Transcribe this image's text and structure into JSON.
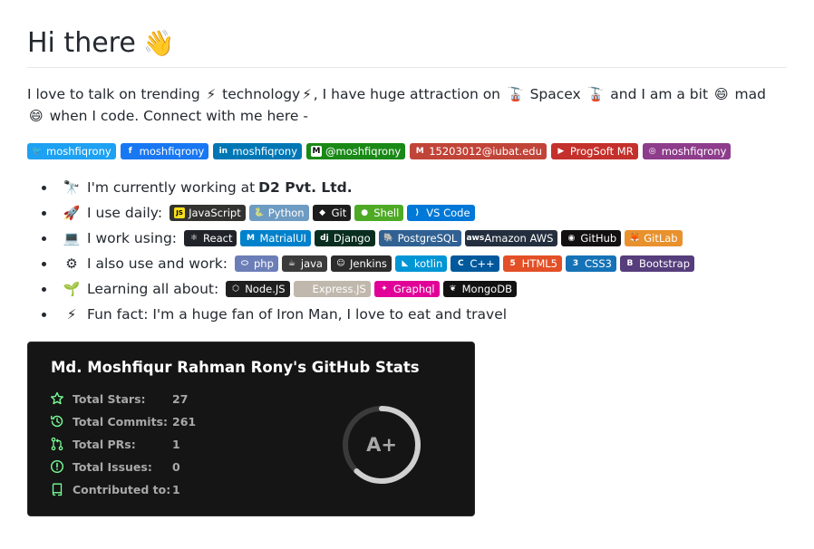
{
  "heading": {
    "text": "Hi there",
    "emoji": "👋"
  },
  "intro": {
    "p1": "I love to talk on trending",
    "e1": "⚡",
    "p2": "technology",
    "e2": "⚡",
    "p3": ", I have huge attraction on",
    "e3": "🚡",
    "p4": "Spacex",
    "e4": "🚡",
    "p5": "and I am a bit",
    "e5": "😄",
    "p6": "mad",
    "e6": "😄",
    "p7": "when I code. Connect with me here -"
  },
  "social": [
    {
      "label": "moshfiqrony",
      "icon": "twitter-icon",
      "glyph": "🐦",
      "color": "#1DA1F2"
    },
    {
      "label": "moshfiqrony",
      "icon": "facebook-icon",
      "glyph": "f",
      "color": "#1877F2"
    },
    {
      "label": "moshfiqrony",
      "icon": "linkedin-icon",
      "glyph": "in",
      "color": "#0077B5"
    },
    {
      "label": "@moshfiqrony",
      "icon": "medium-icon",
      "glyph": "M",
      "color": "#12100E",
      "accent": "#1a8917"
    },
    {
      "label": "15203012@iubat.edu",
      "icon": "gmail-icon",
      "glyph": "M",
      "color": "#C14438"
    },
    {
      "label": "ProgSoft MR",
      "icon": "youtube-icon",
      "glyph": "▶",
      "color": "#C4302B"
    },
    {
      "label": "moshfiqrony",
      "icon": "instagram-icon",
      "glyph": "◎",
      "color": "#8E3C8C"
    }
  ],
  "list": {
    "work": {
      "emoji": "🔭",
      "text": "I'm currently working at",
      "strong": "D2 Pvt. Ltd."
    },
    "daily": {
      "emoji": "🚀",
      "text": "I use daily:",
      "badges": [
        {
          "label": "JavaScript",
          "icon": "javascript-icon",
          "glyph": "JS",
          "color": "#323330",
          "icolor": "#F7DF1E"
        },
        {
          "label": "Python",
          "icon": "python-icon",
          "glyph": "🐍",
          "color": "#3776AB",
          "faded": true
        },
        {
          "label": "Git",
          "icon": "git-icon",
          "glyph": "◆",
          "color": "#1d1d1d"
        },
        {
          "label": "Shell",
          "icon": "shell-icon",
          "glyph": "●",
          "color": "#4EAA25"
        },
        {
          "label": "VS Code",
          "icon": "vscode-icon",
          "glyph": "⟩",
          "color": "#0078D7"
        }
      ]
    },
    "using": {
      "emoji": "💻",
      "text": "I work using:",
      "badges": [
        {
          "label": "React",
          "icon": "react-icon",
          "glyph": "⚛",
          "color": "#20232A"
        },
        {
          "label": "MatrialUI",
          "icon": "materialui-icon",
          "glyph": "M",
          "color": "#0081CB"
        },
        {
          "label": "Django",
          "icon": "django-icon",
          "glyph": "dj",
          "color": "#092E20"
        },
        {
          "label": "PostgreSQL",
          "icon": "postgresql-icon",
          "glyph": "🐘",
          "color": "#316192"
        },
        {
          "label": "Amazon AWS",
          "icon": "aws-icon",
          "glyph": "aws",
          "color": "#232F3E"
        },
        {
          "label": "GitHub",
          "icon": "github-icon",
          "glyph": "◉",
          "color": "#121011"
        },
        {
          "label": "GitLab",
          "icon": "gitlab-icon",
          "glyph": "🦊",
          "color": "#E8912D"
        }
      ]
    },
    "also": {
      "emoji": "⚙",
      "text": "I also use and work:",
      "badges": [
        {
          "label": "php",
          "icon": "php-icon",
          "glyph": "⬭",
          "color": "#6C7EB7"
        },
        {
          "label": "java",
          "icon": "java-icon",
          "glyph": "☕",
          "color": "#3b3b3b"
        },
        {
          "label": "Jenkins",
          "icon": "jenkins-icon",
          "glyph": "☺",
          "color": "#2C2C2C"
        },
        {
          "label": "kotlin",
          "icon": "kotlin-icon",
          "glyph": "◣",
          "color": "#0095D5"
        },
        {
          "label": "C++",
          "icon": "cplusplus-icon",
          "glyph": "C",
          "color": "#00599C"
        },
        {
          "label": "HTML5",
          "icon": "html5-icon",
          "glyph": "5",
          "color": "#E34F26"
        },
        {
          "label": "CSS3",
          "icon": "css3-icon",
          "glyph": "3",
          "color": "#1572B6"
        },
        {
          "label": "Bootstrap",
          "icon": "bootstrap-icon",
          "glyph": "B",
          "color": "#563D7C"
        }
      ]
    },
    "learning": {
      "emoji": "🌱",
      "text": "Learning all about:",
      "badges": [
        {
          "label": "Node.JS",
          "icon": "nodejs-icon",
          "glyph": "⬡",
          "color": "#1f1f1f"
        },
        {
          "label": "Express.JS",
          "icon": "express-icon",
          "glyph": "",
          "color": "#A89D8E",
          "faded": true
        },
        {
          "label": "Graphql",
          "icon": "graphql-icon",
          "glyph": "✦",
          "color": "#E10098"
        },
        {
          "label": "MongoDB",
          "icon": "mongodb-icon",
          "glyph": "❦",
          "color": "#121212"
        }
      ]
    },
    "fun": {
      "emoji": "⚡",
      "text": "Fun fact: I'm a huge fan of Iron Man, I love to eat and travel"
    }
  },
  "stats": {
    "title": "Md. Moshfiqur Rahman Rony's GitHub Stats",
    "rows": [
      {
        "label": "Total Stars:",
        "value": "27",
        "icon": "star-icon"
      },
      {
        "label": "Total Commits:",
        "value": "261",
        "icon": "history-icon"
      },
      {
        "label": "Total PRs:",
        "value": "1",
        "icon": "pull-request-icon"
      },
      {
        "label": "Total Issues:",
        "value": "0",
        "icon": "issue-icon"
      },
      {
        "label": "Contributed to:",
        "value": "1",
        "icon": "repo-icon"
      }
    ],
    "grade": "A+",
    "grade_progress": 0.62,
    "colors": {
      "bg": "#151515",
      "icon": "#79ff97",
      "text": "#a8a8a8",
      "title": "#ffffff",
      "ring": "#d0d0d0",
      "ring_track": "#3a3a3a"
    }
  }
}
